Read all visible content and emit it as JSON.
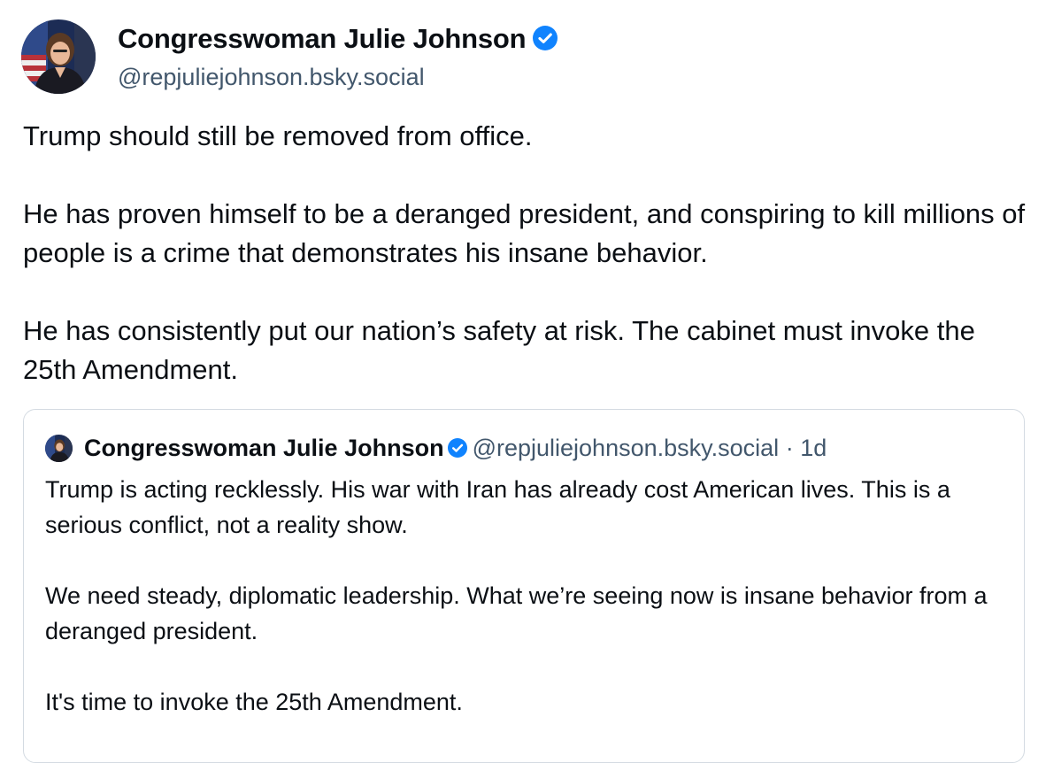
{
  "post": {
    "author": {
      "display_name": "Congresswoman Julie Johnson",
      "handle": "@repjuliejohnson.bsky.social",
      "verified": true
    },
    "paragraphs": [
      "Trump should still be removed from office.",
      "He has proven himself to be a deranged president, and conspiring to kill millions of people is a crime that demonstrates his insane behavior.",
      "He has consistently put our nation’s safety at risk. The cabinet must invoke the 25th Amendment."
    ]
  },
  "quote": {
    "author": {
      "display_name": "Congresswoman Julie Johnson",
      "handle": "@repjuliejohnson.bsky.social",
      "verified": true
    },
    "separator": "·",
    "time": "1d",
    "paragraphs": [
      "Trump is acting recklessly. His war with Iran has already cost American lives. This is a serious conflict, not a reality show.",
      "We need steady, diplomatic leadership. What we’re seeing now is insane behavior from a deranged president.",
      "It's time to invoke the 25th Amendment."
    ]
  },
  "icons": {
    "verified": "verified-check-icon",
    "avatar": "profile-photo"
  },
  "colors": {
    "text": "#0b0f14",
    "muted": "#42576c",
    "verified_blue": "#1083fe",
    "border": "#d4dbe2"
  }
}
